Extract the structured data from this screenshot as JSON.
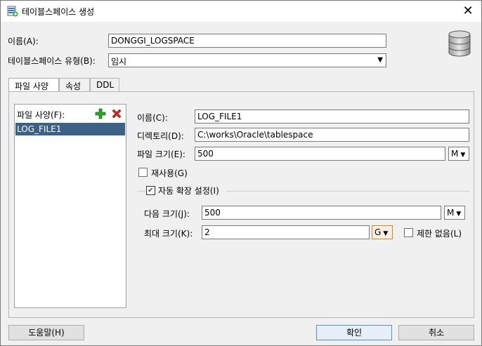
{
  "window": {
    "title": "테이블스페이스 생성"
  },
  "header": {
    "name_label": "이름(A):",
    "name_value": "DONGGI_LOGSPACE",
    "type_label": "테이블스페이스 유형(B):",
    "type_value": "임시"
  },
  "tabs": [
    {
      "label": "파일 사양"
    },
    {
      "label": "속성"
    },
    {
      "label": "DDL"
    }
  ],
  "file_spec": {
    "list_label": "파일 사양(F):",
    "items": [
      "LOG_FILE1"
    ],
    "name_label": "이름(C):",
    "name_value": "LOG_FILE1",
    "dir_label": "디렉토리(D):",
    "dir_value": "C:\\works\\Oracle\\tablespace",
    "size_label": "파일 크기(E):",
    "size_value": "500",
    "size_unit": "M",
    "reuse_label": "재사용(G)",
    "reuse_checked": false,
    "autoextend_label": "자동 확장 설정(I)",
    "autoextend_checked": true,
    "next_label": "다음 크기(J):",
    "next_value": "500",
    "next_unit": "M",
    "max_label": "최대 크기(K):",
    "max_value": "2",
    "max_unit": "G",
    "unlimited_label": "제한 없음(L)",
    "unlimited_checked": false
  },
  "footer": {
    "help_label": "도움말(H)",
    "ok_label": "확인",
    "cancel_label": "취소"
  }
}
